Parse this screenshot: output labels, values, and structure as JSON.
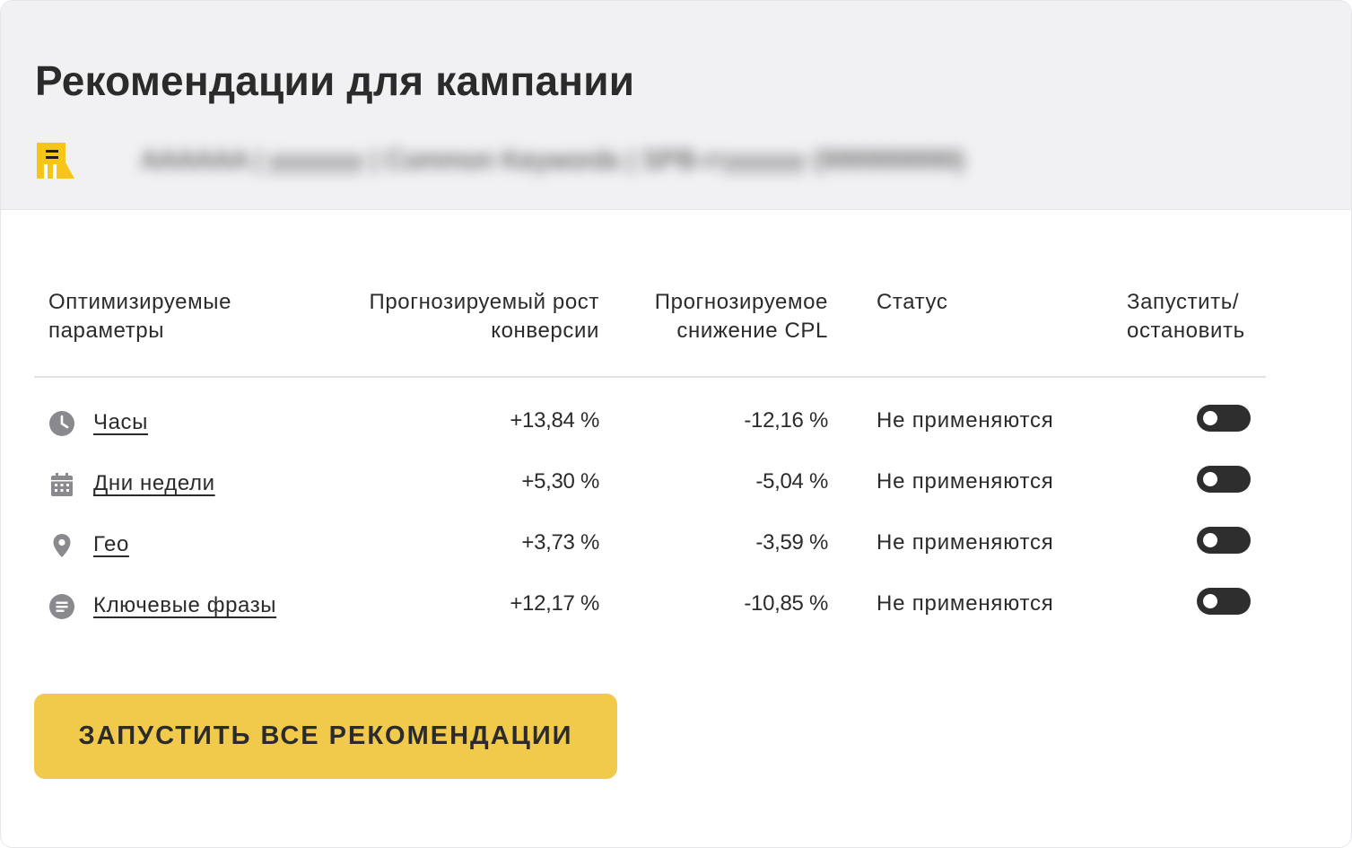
{
  "header": {
    "title": "Рекомендации для кампании",
    "campaign_name": "AAAAAA | yyyyyyy | Common Keywords | SPB-ггyyyyyy (999999999)"
  },
  "table": {
    "columns": {
      "params": [
        "Оптимизируемые",
        "параметры"
      ],
      "conversion": [
        "Прогнозируемый рост",
        "конверсии"
      ],
      "cpl": [
        "Прогнозируемое",
        "снижение CPL"
      ],
      "status": [
        "Статус"
      ],
      "toggle": [
        "Запустить/",
        "остановить"
      ]
    },
    "rows": [
      {
        "icon": "clock-icon",
        "name": "Часы",
        "conversion": "+13,84 %",
        "cpl": "-12,16 %",
        "status": "Не применяются",
        "enabled": false
      },
      {
        "icon": "calendar-icon",
        "name": "Дни недели",
        "conversion": "+5,30 %",
        "cpl": "-5,04 %",
        "status": "Не применяются",
        "enabled": false
      },
      {
        "icon": "location-pin-icon",
        "name": "Гео",
        "conversion": "+3,73 %",
        "cpl": "-3,59 %",
        "status": "Не применяются",
        "enabled": false
      },
      {
        "icon": "text-lines-icon",
        "name": "Ключевые фразы",
        "conversion": "+12,17 %",
        "cpl": "-10,85 %",
        "status": "Не применяются",
        "enabled": false
      }
    ]
  },
  "actions": {
    "run_all_label": "ЗАПУСТИТЬ ВСЕ РЕКОМЕНДАЦИИ"
  },
  "colors": {
    "accent": "#f1c94b",
    "logo": "#f5c518",
    "toggle_off": "#2e2e2e",
    "icon": "#8a8a8e"
  }
}
